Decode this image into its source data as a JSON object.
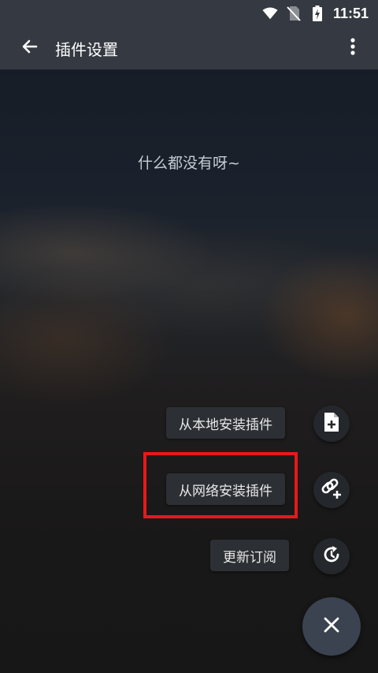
{
  "status_bar": {
    "time": "11:51"
  },
  "app_bar": {
    "title": "插件设置"
  },
  "empty_state": {
    "text": "什么都没有呀~"
  },
  "fab_menu": {
    "items": [
      {
        "label": "从本地安装插件",
        "icon": "file-plus-icon"
      },
      {
        "label": "从网络安装插件",
        "icon": "link-plus-icon"
      },
      {
        "label": "更新订阅",
        "icon": "refresh-icon"
      }
    ],
    "close_icon": "close-icon"
  },
  "colors": {
    "toolbar": "#353a42",
    "highlight": "#e8181b",
    "fab_main": "#3b4351"
  }
}
